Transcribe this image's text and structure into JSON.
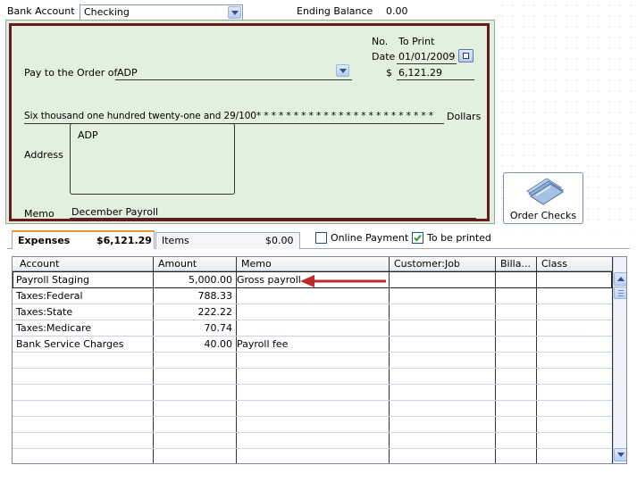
{
  "top_bar": {
    "bank_account_label": "Bank Account",
    "bank_account_value": "Checking",
    "ending_balance_label": "Ending Balance",
    "ending_balance_value": "0.00"
  },
  "check": {
    "no_label": "No.",
    "no_value": "To Print",
    "date_label": "Date",
    "date_value": "01/01/2009",
    "pay_to_label": "Pay to the Order of",
    "payee": "ADP",
    "dollar_sign": "$",
    "amount": "6,121.29",
    "amount_words": "Six thousand one hundred twenty-one and 29/100* * * * * * * * * * * * * * * * * * * * * * * *",
    "dollars_label": "Dollars",
    "address_label": "Address",
    "address_value": "ADP",
    "memo_label": "Memo",
    "memo_value": "December Payroll"
  },
  "order_checks": {
    "label": "Order Checks",
    "icon": "checkbook-icon"
  },
  "tabs": {
    "expenses_label": "Expenses",
    "expenses_total": "$6,121.29",
    "items_label": "Items",
    "items_total": "$0.00"
  },
  "options": {
    "online_payment_label": "Online Payment",
    "online_payment_checked": false,
    "to_be_printed_label": "To be printed",
    "to_be_printed_checked": true
  },
  "grid": {
    "headers": [
      "Account",
      "Amount",
      "Memo",
      "Customer:Job",
      "Billa...",
      "Class"
    ],
    "rows": [
      {
        "account": "Payroll Staging",
        "amount": "5,000.00",
        "memo": "Gross payroll"
      },
      {
        "account": "Taxes:Federal",
        "amount": "788.33",
        "memo": ""
      },
      {
        "account": "Taxes:State",
        "amount": "222.22",
        "memo": ""
      },
      {
        "account": "Taxes:Medicare",
        "amount": "70.74",
        "memo": ""
      },
      {
        "account": "Bank Service Charges",
        "amount": "40.00",
        "memo": "Payroll fee"
      }
    ]
  },
  "colors": {
    "check_bg": "#e2f0de",
    "check_border": "#6a1a1f",
    "arrow": "#c0282a",
    "tab_accent": "#e39a2b"
  }
}
